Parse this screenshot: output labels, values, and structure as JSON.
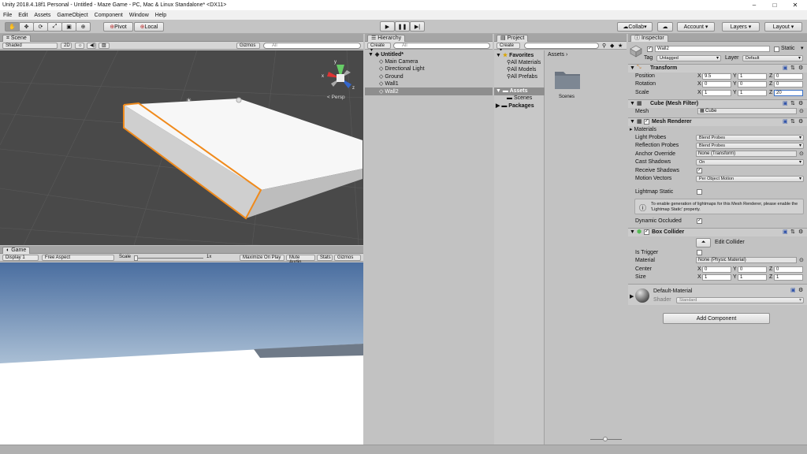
{
  "window": {
    "title": "Unity 2018.4.18f1 Personal - Untitled - Maze Game - PC, Mac & Linux Standalone* <DX11>",
    "min": "–",
    "max": "□",
    "close": "✕"
  },
  "menu": [
    "File",
    "Edit",
    "Assets",
    "GameObject",
    "Component",
    "Window",
    "Help"
  ],
  "toolbar": {
    "pivot": "Pivot",
    "local": "Local",
    "collab": "Collab",
    "account": "Account",
    "layers": "Layers",
    "layout": "Layout"
  },
  "scene": {
    "tab": "Scene",
    "shaded": "Shaded",
    "mode2d": "2D",
    "gizmos": "Gizmos",
    "search": "All",
    "persp": "< Persp"
  },
  "game": {
    "tab": "Game",
    "display": "Display 1",
    "aspect": "Free Aspect",
    "scale_label": "Scale",
    "scale_value": "1x",
    "maximize": "Maximize On Play",
    "mute": "Mute Audio",
    "stats": "Stats",
    "gizmos": "Gizmos"
  },
  "hierarchy": {
    "tab": "Hierarchy",
    "create": "Create",
    "search": "All",
    "scene": "Untitled*",
    "items": [
      "Main Camera",
      "Directional Light",
      "Ground",
      "Wall1",
      "Wall2"
    ]
  },
  "project": {
    "tab": "Project",
    "create": "Create",
    "favorites": "Favorites",
    "fav_items": [
      "All Materials",
      "All Models",
      "All Prefabs"
    ],
    "assets": "Assets",
    "asset_children": [
      "Scenes"
    ],
    "packages": "Packages",
    "breadcrumb": "Assets",
    "folder": "Scenes"
  },
  "inspector": {
    "tab": "Inspector",
    "name": "Wall2",
    "static": "Static",
    "tag_label": "Tag",
    "tag": "Untagged",
    "layer_label": "Layer",
    "layer": "Default",
    "transform": {
      "title": "Transform",
      "position": "Position",
      "rotation": "Rotation",
      "scale": "Scale",
      "pos": [
        "9.5",
        "1",
        "0"
      ],
      "rot": [
        "0",
        "0",
        "0"
      ],
      "scl": [
        "1",
        "1",
        "20"
      ]
    },
    "mesh_filter": {
      "title": "Cube (Mesh Filter)",
      "mesh_label": "Mesh",
      "mesh": "Cube"
    },
    "mesh_renderer": {
      "title": "Mesh Renderer",
      "materials": "Materials",
      "light_probes": "Light Probes",
      "light_probes_val": "Blend Probes",
      "reflection_probes": "Reflection Probes",
      "reflection_probes_val": "Blend Probes",
      "anchor": "Anchor Override",
      "anchor_val": "None (Transform)",
      "cast": "Cast Shadows",
      "cast_val": "On",
      "receive": "Receive Shadows",
      "motion": "Motion Vectors",
      "motion_val": "Per Object Motion",
      "lightmap_static": "Lightmap Static",
      "info": "To enable generation of lightmaps for this Mesh Renderer, please enable the 'Lightmap Static' property.",
      "dynamic": "Dynamic Occluded"
    },
    "box_collider": {
      "title": "Box Collider",
      "edit": "Edit Collider",
      "trigger": "Is Trigger",
      "material": "Material",
      "material_val": "None (Physic Material)",
      "center": "Center",
      "size": "Size",
      "center_v": [
        "0",
        "0",
        "0"
      ],
      "size_v": [
        "1",
        "1",
        "1"
      ]
    },
    "material": {
      "name": "Default-Material",
      "shader_label": "Shader",
      "shader": "Standard"
    },
    "add_component": "Add Component",
    "axes": [
      "X",
      "Y",
      "Z"
    ]
  }
}
